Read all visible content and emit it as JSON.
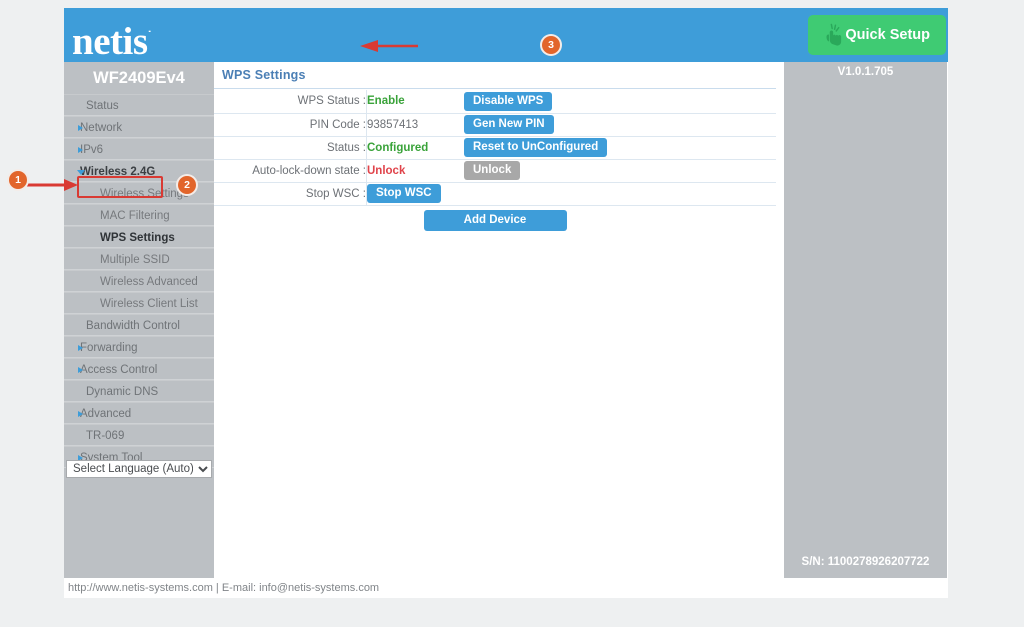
{
  "header": {
    "brand": "netis",
    "brand_mark": "˙",
    "quick_setup_label": "Quick Setup",
    "quick_setup_icon": "hand-click-icon",
    "brand_bg": "#3e9dd9",
    "quick_setup_bg": "#3fcb73"
  },
  "sidebar": {
    "model": "WF2409Ev4",
    "items": [
      {
        "label": "Status",
        "level": "top",
        "expandable": false
      },
      {
        "label": "Network",
        "level": "top",
        "expandable": true
      },
      {
        "label": "IPv6",
        "level": "top",
        "expandable": true
      },
      {
        "label": "Wireless 2.4G",
        "level": "top",
        "expandable": true,
        "expanded": true,
        "active": true
      },
      {
        "label": "Wireless Settings",
        "level": "sub"
      },
      {
        "label": "MAC Filtering",
        "level": "sub"
      },
      {
        "label": "WPS Settings",
        "level": "sub",
        "selected": true
      },
      {
        "label": "Multiple SSID",
        "level": "sub"
      },
      {
        "label": "Wireless Advanced",
        "level": "sub"
      },
      {
        "label": "Wireless Client List",
        "level": "sub"
      },
      {
        "label": "Bandwidth Control",
        "level": "top",
        "expandable": false
      },
      {
        "label": "Forwarding",
        "level": "top",
        "expandable": true
      },
      {
        "label": "Access Control",
        "level": "top",
        "expandable": true
      },
      {
        "label": "Dynamic DNS",
        "level": "top",
        "expandable": false
      },
      {
        "label": "Advanced",
        "level": "top",
        "expandable": true
      },
      {
        "label": "TR-069",
        "level": "top",
        "expandable": false
      },
      {
        "label": "System Tool",
        "level": "top",
        "expandable": true
      }
    ],
    "language_select": {
      "selected": "Select Language (Auto)",
      "options": [
        "Select Language (Auto)"
      ]
    }
  },
  "main": {
    "panel_title": "WPS Settings",
    "rows": [
      {
        "label": "WPS Status :",
        "value": "Enable",
        "value_style": "green",
        "button": "Disable WPS",
        "button_style": "blue"
      },
      {
        "label": "PIN Code :",
        "value": "93857413",
        "value_style": "plain",
        "button": "Gen New PIN",
        "button_style": "blue"
      },
      {
        "label": "Status :",
        "value": "Configured",
        "value_style": "green",
        "button": "Reset to UnConfigured",
        "button_style": "blue"
      },
      {
        "label": "Auto-lock-down state :",
        "value": "Unlock",
        "value_style": "red",
        "button": "Unlock",
        "button_style": "grey"
      },
      {
        "label": "Stop WSC :",
        "value": "",
        "value_style": "plain",
        "button": "Stop WSC",
        "button_style": "blue",
        "button_in_value_column": true
      }
    ],
    "add_device_label": "Add Device"
  },
  "right_panel": {
    "firmware_version": "V1.0.1.705",
    "serial_number": "S/N: 1100278926207722"
  },
  "footer": {
    "text": "http://www.netis-systems.com | E-mail: info@netis-systems.com"
  },
  "annotations": {
    "step1": "1",
    "step2": "2",
    "step3": "3",
    "marker_color": "#e2652b",
    "arrow_color": "#d93a33",
    "highlight_color": "#d93a33"
  }
}
